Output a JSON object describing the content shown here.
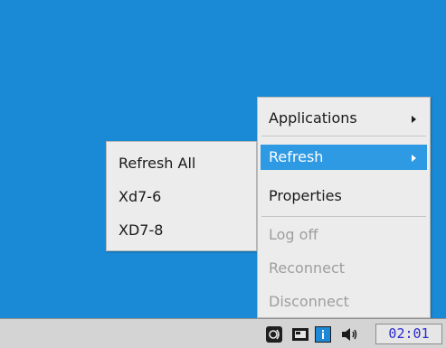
{
  "submenu": {
    "items": [
      {
        "label": "Refresh All"
      },
      {
        "label": "Xd7-6"
      },
      {
        "label": "XD7-8"
      }
    ]
  },
  "menu": {
    "items": [
      {
        "label": "Applications",
        "has_submenu": true,
        "enabled": true
      },
      {
        "label": "Refresh",
        "has_submenu": true,
        "enabled": true,
        "selected": true
      },
      {
        "label": "Properties",
        "enabled": true
      },
      {
        "label": "Log off",
        "enabled": false
      },
      {
        "label": "Reconnect",
        "enabled": false
      },
      {
        "label": "Disconnect",
        "enabled": false
      }
    ]
  },
  "taskbar": {
    "tray_icons": [
      "receiver-icon",
      "monitor-icon",
      "info-icon",
      "speaker-icon"
    ],
    "clock": "02:01"
  },
  "colors": {
    "desktop": "#1a8ad6",
    "highlight": "#2e9ae3",
    "menu_bg": "#ececec",
    "clock_text": "#2a2ad0"
  }
}
